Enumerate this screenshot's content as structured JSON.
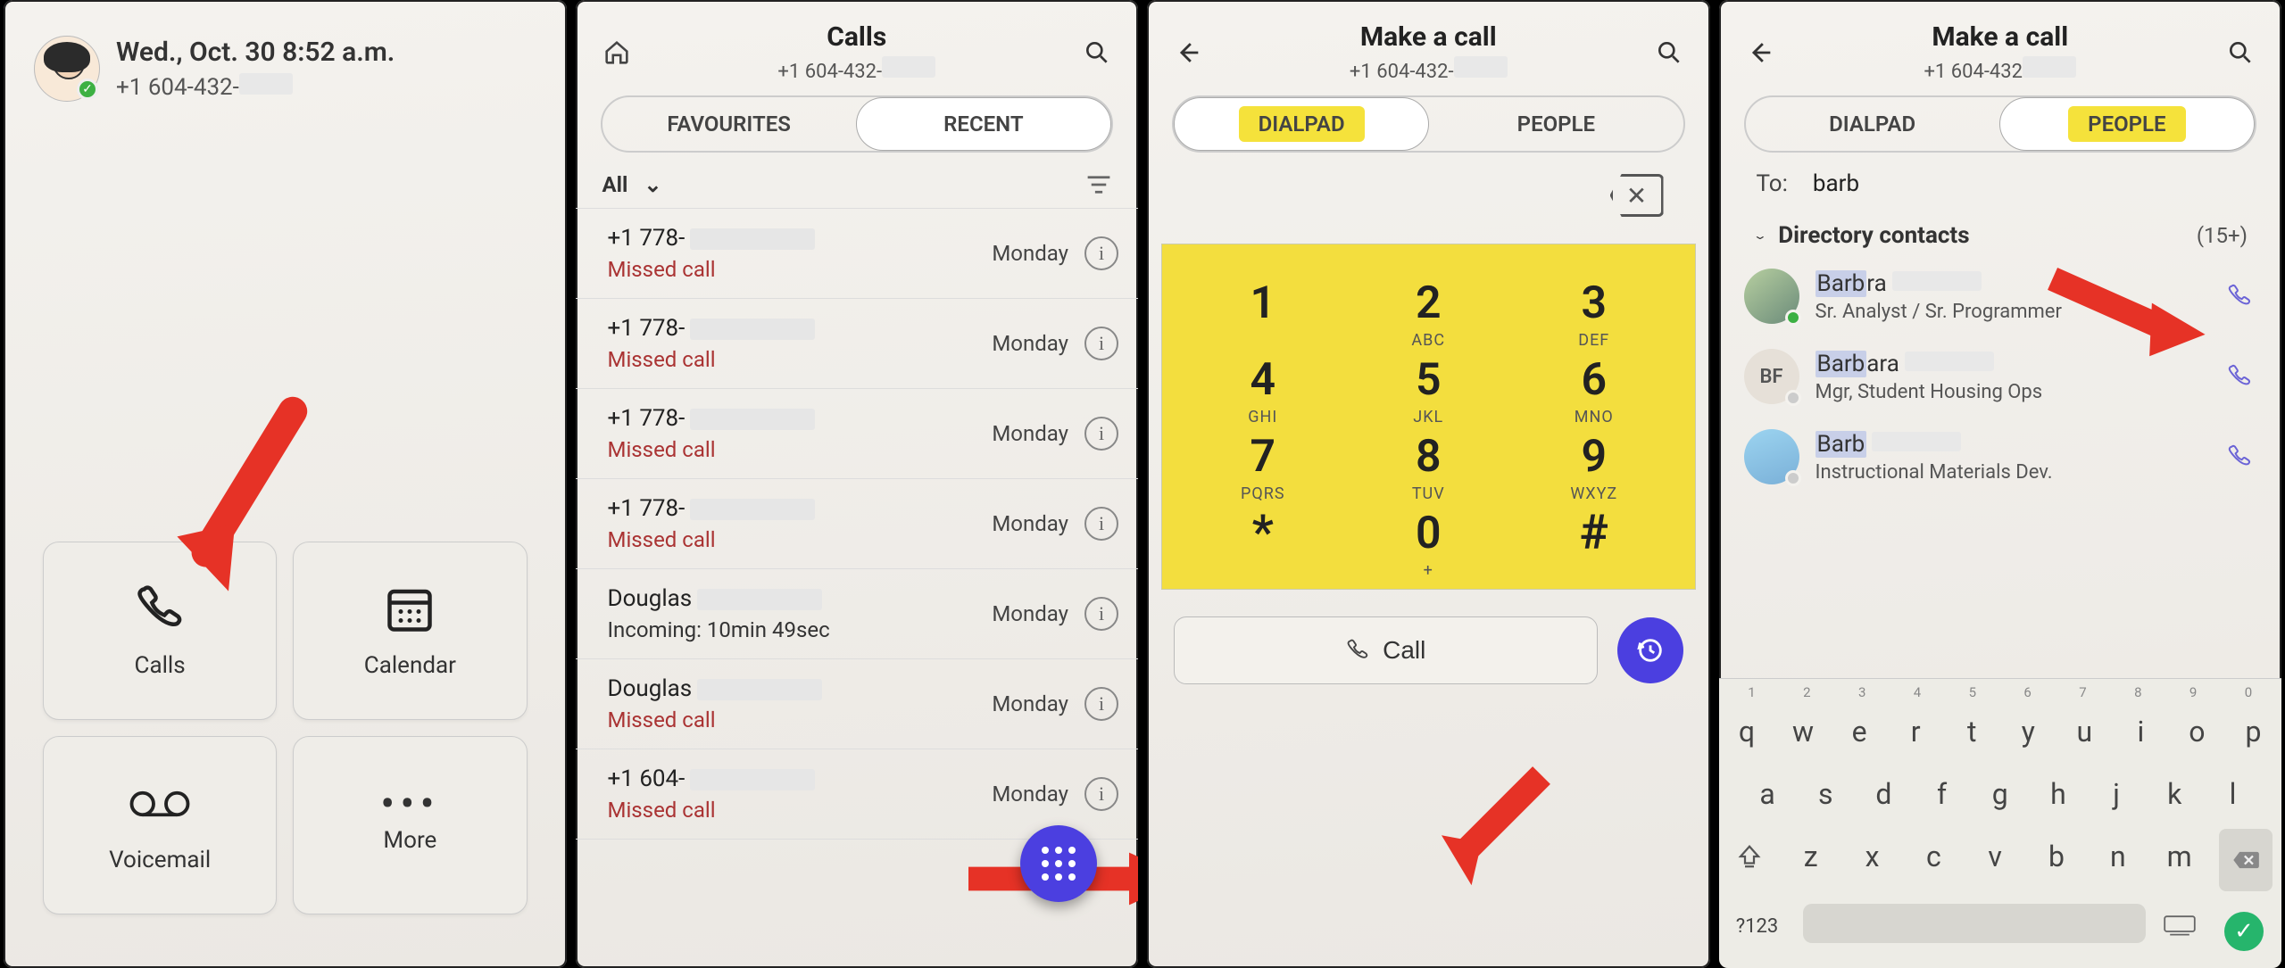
{
  "panel1": {
    "datetime": "Wed., Oct. 30 8:52 a.m.",
    "phone_prefix": "+1 604-432-",
    "tiles": {
      "calls": "Calls",
      "calendar": "Calendar",
      "voicemail": "Voicemail",
      "more": "More"
    }
  },
  "panel2": {
    "title": "Calls",
    "sub_prefix": "+1 604-432-",
    "tabs": {
      "fav": "FAVOURITES",
      "recent": "RECENT"
    },
    "filter": "All",
    "rows": [
      {
        "num": "+1 778-",
        "status": "Missed call",
        "missed": true,
        "day": "Monday"
      },
      {
        "num": "+1 778-",
        "status": "Missed call",
        "missed": true,
        "day": "Monday"
      },
      {
        "num": "+1 778-",
        "status": "Missed call",
        "missed": true,
        "day": "Monday"
      },
      {
        "num": "+1 778-",
        "status": "Missed call",
        "missed": true,
        "day": "Monday"
      },
      {
        "num": "Douglas",
        "status": "Incoming: 10min 49sec",
        "missed": false,
        "day": "Monday"
      },
      {
        "num": "Douglas",
        "status": "Missed call",
        "missed": true,
        "day": "Monday"
      },
      {
        "num": "+1 604-",
        "status": "Missed call",
        "missed": true,
        "day": "Monday"
      }
    ]
  },
  "panel3": {
    "title": "Make a call",
    "sub_prefix": "+1 604-432-",
    "tabs": {
      "dialpad": "DIALPAD",
      "people": "PEOPLE"
    },
    "keys": [
      {
        "n": "1",
        "t": ""
      },
      {
        "n": "2",
        "t": "ABC"
      },
      {
        "n": "3",
        "t": "DEF"
      },
      {
        "n": "4",
        "t": "GHI"
      },
      {
        "n": "5",
        "t": "JKL"
      },
      {
        "n": "6",
        "t": "MNO"
      },
      {
        "n": "7",
        "t": "PQRS"
      },
      {
        "n": "8",
        "t": "TUV"
      },
      {
        "n": "9",
        "t": "WXYZ"
      },
      {
        "n": "*",
        "t": ""
      },
      {
        "n": "0",
        "t": "+"
      },
      {
        "n": "#",
        "t": ""
      }
    ],
    "call_label": "Call"
  },
  "panel4": {
    "title": "Make a call",
    "sub_prefix": "+1 604-432",
    "tabs": {
      "dialpad": "DIALPAD",
      "people": "PEOPLE"
    },
    "to_label": "To:",
    "to_value": "barb",
    "dir_header": "Directory contacts",
    "dir_count": "(15+)",
    "contacts": [
      {
        "name": "Barbra",
        "role": "Sr. Analyst / Sr. Programmer",
        "hi": 4,
        "presence": "g"
      },
      {
        "name": "Barbara",
        "role": "Mgr, Student Housing Ops",
        "hi": 4,
        "presence": "w",
        "initials": "BF"
      },
      {
        "name": "Barb",
        "role": "Instructional Materials Dev.",
        "hi": 4,
        "presence": "w"
      }
    ],
    "kbd": {
      "nums": [
        "1",
        "2",
        "3",
        "4",
        "5",
        "6",
        "7",
        "8",
        "9",
        "0"
      ],
      "r1": [
        "q",
        "w",
        "e",
        "r",
        "t",
        "y",
        "u",
        "i",
        "o",
        "p"
      ],
      "r2": [
        "a",
        "s",
        "d",
        "f",
        "g",
        "h",
        "j",
        "k",
        "l"
      ],
      "r3": [
        "z",
        "x",
        "c",
        "v",
        "b",
        "n",
        "m"
      ],
      "sym": "?123"
    }
  }
}
